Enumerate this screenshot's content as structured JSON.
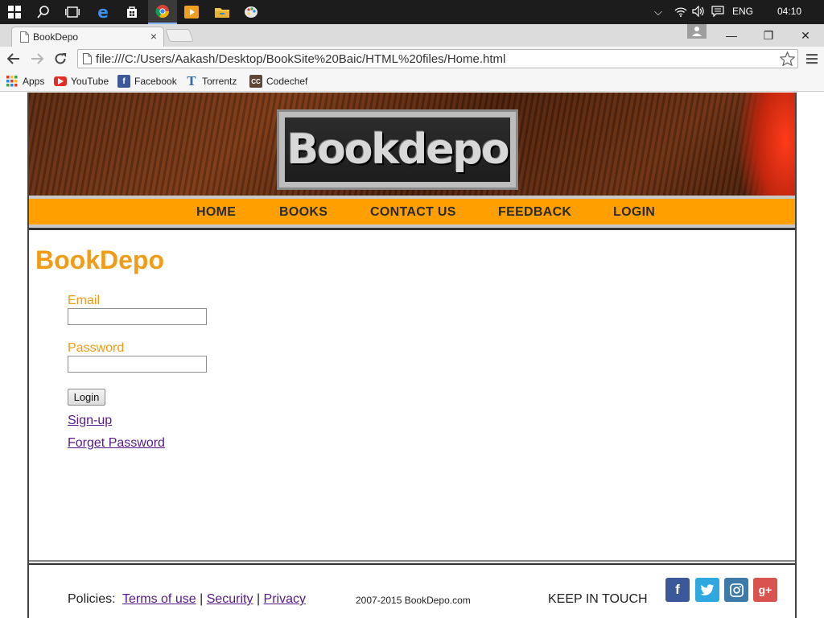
{
  "taskbar": {
    "language": "ENG",
    "clock": "04:10"
  },
  "browser": {
    "tab_title": "BookDepo",
    "tab_close": "×",
    "url": "file:///C:/Users/Aakash/Desktop/BookSite%20Baic/HTML%20files/Home.html",
    "window_controls": {
      "minimize": "—",
      "restore": "❐",
      "close": "✕"
    }
  },
  "bookmarks": [
    {
      "label": "Apps",
      "icon": "apps-grid-icon",
      "color": "#e53935"
    },
    {
      "label": "YouTube",
      "icon": "youtube-icon",
      "color": "#e52d27"
    },
    {
      "label": "Facebook",
      "icon": "facebook-icon",
      "color": "#3b5998"
    },
    {
      "label": "Torrentz",
      "icon": "torrentz-icon",
      "color": "#3c6ea6"
    },
    {
      "label": "Codechef",
      "icon": "codechef-icon",
      "color": "#5b4638"
    }
  ],
  "site": {
    "logo": "Bookdepo",
    "title": "BookDepo",
    "accent": "#f29b16",
    "nav": [
      "HOME",
      "BOOKS",
      "CONTACT US",
      "FEEDBACK",
      "LOGIN"
    ]
  },
  "login": {
    "email_label": "Email",
    "email_value": "",
    "password_label": "Password",
    "password_value": "",
    "submit": "Login",
    "signup": "Sign-up",
    "forgot": "Forget Password"
  },
  "footer": {
    "policies_label": "Policies:",
    "links": [
      "Terms of use",
      "Security",
      "Privacy"
    ],
    "separator": "|",
    "copyright": "2007-2015 BookDepo.com",
    "keep_in_touch": "KEEP IN TOUCH",
    "social": [
      {
        "name": "facebook-icon",
        "glyph": "f",
        "color": "#3b5998"
      },
      {
        "name": "twitter-icon",
        "glyph": "t",
        "color": "#2fa8e0"
      },
      {
        "name": "instagram-icon",
        "glyph": "◙",
        "color": "#3d7aa8"
      },
      {
        "name": "google-plus-icon",
        "glyph": "g+",
        "color": "#d9534f"
      }
    ]
  }
}
